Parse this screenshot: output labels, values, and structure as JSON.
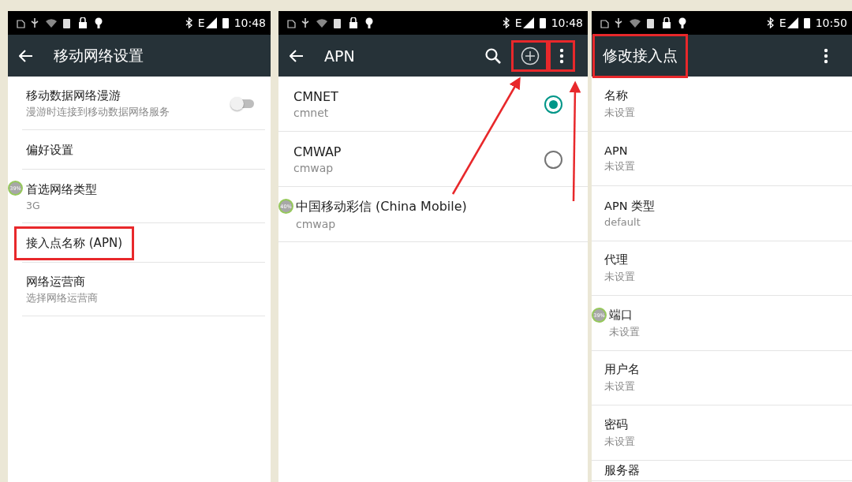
{
  "screens": [
    {
      "kind": "settings",
      "status_bar": {
        "network": "E",
        "time": "10:48"
      },
      "toolbar": {
        "back": true,
        "title": "移动网络设置"
      },
      "rows": [
        {
          "kind": "switch",
          "title": "移动数据网络漫游",
          "summary": "漫游时连接到移动数据网络服务",
          "on": false
        },
        {
          "kind": "text",
          "title": "偏好设置"
        },
        {
          "kind": "text",
          "title": "首选网络类型",
          "summary": "3G",
          "badge": "39%"
        },
        {
          "kind": "text",
          "title": "接入点名称 (APN)",
          "highlighted": true
        },
        {
          "kind": "text",
          "title": "网络运营商",
          "summary": "选择网络运营商"
        }
      ]
    },
    {
      "kind": "apn",
      "status_bar": {
        "network": "E",
        "time": "10:48"
      },
      "toolbar": {
        "back": true,
        "title": "APN",
        "actions": [
          {
            "kind": "search"
          },
          {
            "kind": "add",
            "highlighted": true
          },
          {
            "kind": "more",
            "highlighted": true
          }
        ]
      },
      "annotation_arrows": true,
      "rows": [
        {
          "kind": "radio",
          "title": "CMNET",
          "summary": "cmnet",
          "selected": true
        },
        {
          "kind": "radio",
          "title": "CMWAP",
          "summary": "cmwap",
          "selected": false
        },
        {
          "kind": "text",
          "title": "中国移动彩信 (China Mobile)",
          "summary": "cmwap",
          "badge": "40%"
        }
      ]
    },
    {
      "kind": "edit",
      "status_bar": {
        "network": "E",
        "time": "10:50"
      },
      "toolbar": {
        "title": "修改接入点",
        "highlighted": true,
        "actions": [
          {
            "kind": "more"
          }
        ]
      },
      "rows": [
        {
          "kind": "text",
          "title": "名称",
          "summary": "未设置"
        },
        {
          "kind": "text",
          "title": "APN",
          "summary": "未设置"
        },
        {
          "kind": "text",
          "title": "APN 类型",
          "summary": "default"
        },
        {
          "kind": "text",
          "title": "代理",
          "summary": "未设置"
        },
        {
          "kind": "text",
          "title": "端口",
          "summary": "未设置",
          "badge": "39%"
        },
        {
          "kind": "text",
          "title": "用户名",
          "summary": "未设置"
        },
        {
          "kind": "text",
          "title": "密码",
          "summary": "未设置"
        },
        {
          "kind": "text",
          "title": "服务器"
        }
      ]
    }
  ]
}
